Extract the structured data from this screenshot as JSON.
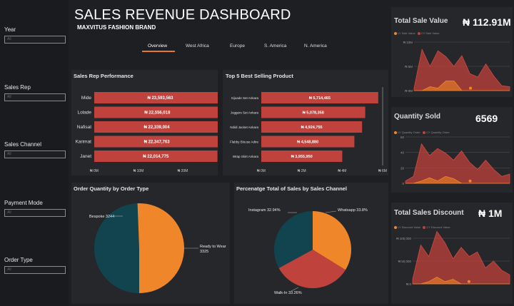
{
  "header": {
    "title": "SALES REVENUE DASHBOARD",
    "subtitle": "MAXVITUS FASHION BRAND",
    "tabs": [
      "Overview",
      "West Africa",
      "Europe",
      "S. America",
      "N. America"
    ]
  },
  "filters": [
    {
      "label": "Year",
      "value": "All"
    },
    {
      "label": "Sales Rep",
      "value": "All"
    },
    {
      "label": "Sales Channel",
      "value": "All"
    },
    {
      "label": "Payment Mode",
      "value": "All"
    },
    {
      "label": "Order Type",
      "value": "All"
    }
  ],
  "kpis": {
    "total_sale_value": {
      "title": "Total Sale Value",
      "value": "₦ 112.91M",
      "legend": [
        "LY Sale Value",
        "CY Sale Value"
      ],
      "ticks": [
        "₦ 10M",
        "₦ 5M",
        "₦ 0M"
      ]
    },
    "quantity_sold": {
      "title": "Quantity Sold",
      "value": "6569",
      "legend": [
        "LY Quantity Order",
        "CY Quantity Order"
      ],
      "ticks": [
        "60",
        "40",
        "20",
        "0"
      ]
    },
    "total_sales_discount": {
      "title": "Total Sales Discount",
      "value": "₦ 1M",
      "legend": [
        "LY Discount Value",
        "CY Discount Value"
      ],
      "ticks": [
        "₦ 100,000",
        "₦ 50,000",
        "₦ 0"
      ]
    }
  },
  "colors": {
    "bar": "#c0423c",
    "orange": "#f0862a",
    "teal": "#12444f",
    "red": "#c0423c",
    "bg": "#1e1f22",
    "panel": "#26272b"
  },
  "chart_data": [
    {
      "type": "bar",
      "title": "Sales Rep Performance",
      "categories": [
        "Mide",
        "Lolade",
        "Nafisat",
        "Karimat",
        "Janet"
      ],
      "values": [
        23593563,
        22556018,
        22339004,
        22347763,
        22014775
      ],
      "data_labels": [
        "₦ 23,593,563",
        "₦ 22,556,018",
        "₦ 22,339,004",
        "₦ 22,347,763",
        "₦ 22,014,775"
      ],
      "xticks": [
        "₦ 0M",
        "₦ 10M",
        "₦ 20M"
      ],
      "xlim": [
        0,
        25000000
      ]
    },
    {
      "type": "bar",
      "title": "Top 5 Best Selling Product",
      "categories": [
        "Sijuade Set Ankara",
        "Joggers Set Ankara",
        "Ndidi Jacket Ankara",
        "Flabby Blouse Adire",
        "Wrap Skirt Ankara"
      ],
      "values": [
        5714465,
        5078358,
        4924755,
        4548880,
        3955950
      ],
      "data_labels": [
        "₦ 5,714,465",
        "₦ 5,078,358",
        "₦ 4,924,755",
        "₦ 4,548,880",
        "₦ 3,955,950"
      ],
      "xticks": [
        "₦ 0M",
        "₦ 2M",
        "₦ 4M",
        "₦ 6M"
      ],
      "xlim": [
        0,
        6000000
      ]
    },
    {
      "type": "pie",
      "title": "Order Quantity by Order Type",
      "categories": [
        "Bespoke",
        "Ready to Wear"
      ],
      "values": [
        3244,
        3325
      ],
      "labels": [
        "Bespoke 3244",
        "Ready to Wear\n3325"
      ]
    },
    {
      "type": "pie",
      "title": "Percenatge Total of Sales by Sales Channel",
      "categories": [
        "Whatsapp",
        "Walk-In",
        "Instagram"
      ],
      "values": [
        33.8,
        33.26,
        32.94
      ],
      "labels": [
        "Whatsapp 33.8%",
        "Walk-In 33.26%",
        "Instagram 32.94%"
      ]
    }
  ]
}
